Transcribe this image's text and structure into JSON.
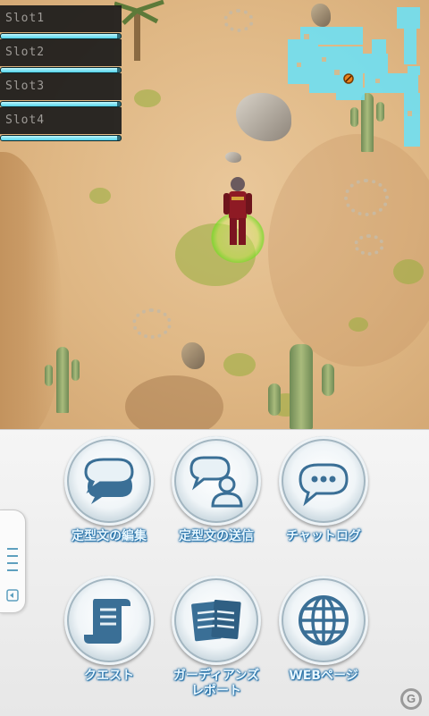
{
  "hud": {
    "party": [
      {
        "name": "Slot1 ",
        "hp": 0.97
      },
      {
        "name": "Slot2 ",
        "hp": 0.97
      },
      {
        "name": "Slot3 ",
        "hp": 0.97
      },
      {
        "name": "Slot4 ",
        "hp": 0.97
      }
    ]
  },
  "menu": {
    "buttons": [
      {
        "label": "定型文の編集",
        "icon": "edit-phrases-icon"
      },
      {
        "label": "定型文の送信",
        "icon": "send-phrases-icon"
      },
      {
        "label": "チャットログ",
        "icon": "chat-log-icon"
      },
      {
        "label": "クエスト",
        "icon": "quest-scroll-icon"
      },
      {
        "label_line1": "ガーディアンズ",
        "label_line2": "レポート",
        "icon": "report-icon"
      },
      {
        "label": "WEBページ",
        "icon": "globe-icon"
      }
    ]
  },
  "colors": {
    "label_text": "#eaf8ff",
    "label_outline": "#1f6da6",
    "hp_fill": "#53d4ea",
    "minimap": "#6fe0f3",
    "icon_blue": "#3a6f96"
  }
}
